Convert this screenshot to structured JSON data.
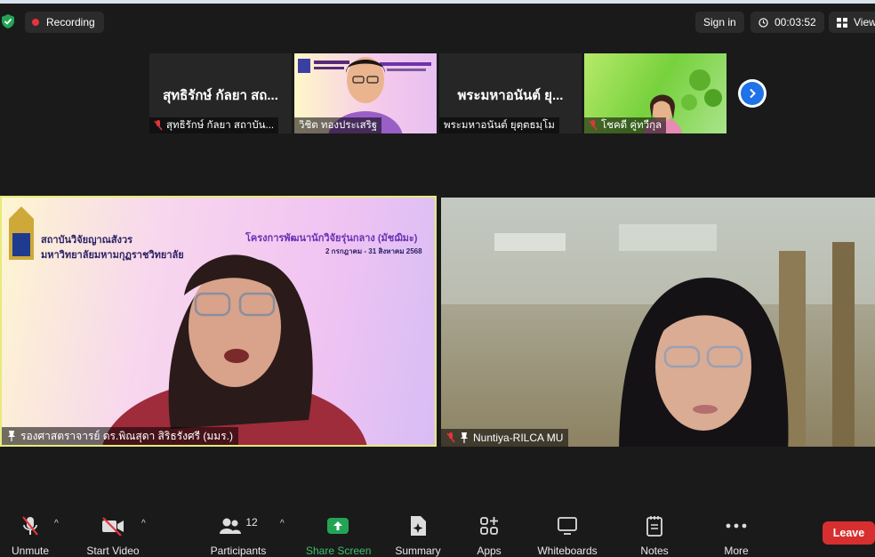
{
  "header": {
    "recording_label": "Recording",
    "sign_in_label": "Sign in",
    "timer": "00:03:52",
    "view_label": "View"
  },
  "thumbnails": [
    {
      "display_name": "สุทธิรักษ์ กัลยา สถ...",
      "label": "สุทธิรักษ์ กัลยา สถาบัน...",
      "muted": true
    },
    {
      "display_name": "",
      "label": "วิชิต ทองประเสริฐ",
      "muted": false
    },
    {
      "display_name": "พระมหาอนันต์ ยุ...",
      "label": "พระมหาอนันต์ ยุตฺตธมฺโม",
      "muted": false
    },
    {
      "display_name": "",
      "label": "โชคดี คู่ทวีกุล",
      "muted": true
    }
  ],
  "main_left": {
    "speaker_label": "รองศาสตราจารย์ ดร.พิณสุดา  สิริธรังศรี (มมร.)",
    "slide_org_line1": "สถาบันวิจัยญาณสังวร",
    "slide_org_line2": "มหาวิทยาลัยมหามกุฏราชวิทยาลัย",
    "slide_title": "โครงการพัฒนานักวิจัยรุ่นกลาง (มัชฌิมะ)",
    "slide_date": "2 กรกฎาคม - 31 สิงหาคม 2568"
  },
  "main_right": {
    "speaker_label": "Nuntiya-RILCA MU"
  },
  "toolbar": {
    "unmute": "Unmute",
    "start_video": "Start Video",
    "participants": "Participants",
    "participants_count": "12",
    "share_screen": "Share Screen",
    "summary": "Summary",
    "apps": "Apps",
    "whiteboards": "Whiteboards",
    "notes": "Notes",
    "more": "More",
    "leave": "Leave"
  },
  "colors": {
    "accent_green": "#23a455",
    "leave_red": "#d72f2f",
    "active_speaker_border": "#e6ea7a",
    "next_blue": "#1f72e8"
  }
}
